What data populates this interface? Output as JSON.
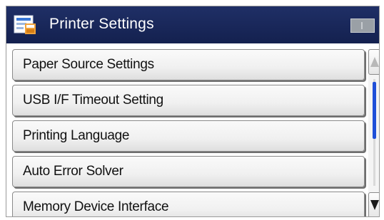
{
  "titlebar": {
    "title": "Printer Settings",
    "icon": "printer-settings-icon"
  },
  "menu": {
    "items": [
      {
        "label": "Paper Source Settings"
      },
      {
        "label": "USB I/F Timeout Setting"
      },
      {
        "label": "Printing Language"
      },
      {
        "label": "Auto Error Solver"
      },
      {
        "label": "Memory Device Interface"
      }
    ]
  },
  "scrollbar": {
    "up_icon": "chevron-up-icon",
    "down_icon": "chevron-down-icon"
  },
  "colors": {
    "titlebar": "#1b2a5c",
    "scroll_thumb": "#1f4fd8"
  }
}
